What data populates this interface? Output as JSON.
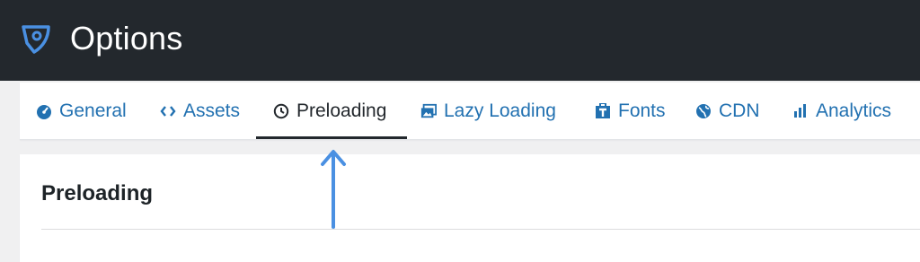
{
  "header": {
    "title": "Options",
    "logo_icon": "rocket-badge-icon",
    "background": "#23282d"
  },
  "tabs": [
    {
      "label": "General",
      "icon": "dashboard-gauge-icon"
    },
    {
      "label": "Assets",
      "icon": "code-brackets-icon"
    },
    {
      "label": "Preloading",
      "icon": "clock-icon",
      "active": true
    },
    {
      "label": "Lazy Loading",
      "icon": "images-icon"
    },
    {
      "label": "Fonts",
      "icon": "font-icon"
    },
    {
      "label": "CDN",
      "icon": "globe-icon"
    },
    {
      "label": "Analytics",
      "icon": "bar-chart-icon"
    }
  ],
  "section": {
    "title": "Preloading"
  },
  "colors": {
    "link": "#2271b1",
    "active_text": "#23282d",
    "annotation_arrow": "#4a90e2"
  }
}
